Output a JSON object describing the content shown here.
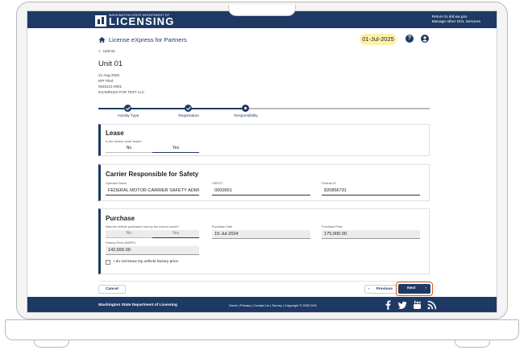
{
  "header": {
    "logo_small": "WASHINGTON STATE DEPARTMENT OF",
    "logo_big": "LICENSING",
    "link_return": "Return to dol.wa.gov",
    "link_manage": "Manage other DOL Services"
  },
  "nav": {
    "app_title": "License eXpress for Partners",
    "date": "01-Jul-2025",
    "help": "?"
  },
  "unit": {
    "back_label": "Unit 01",
    "title": "Unit 01",
    "date": "21-Aug-2026",
    "status": "IRP Filed",
    "account": "0546121-0901",
    "company": "EXAMPLES FOR TEST LLC"
  },
  "stepper": {
    "steps": [
      {
        "label": "Activity Type",
        "state": "complete"
      },
      {
        "label": "Registration",
        "state": "complete"
      },
      {
        "label": "Responsibility",
        "state": "current"
      }
    ]
  },
  "lease": {
    "title": "Lease",
    "question": "Is the vehicle under lease?",
    "options": [
      "No",
      "Yes"
    ],
    "selected": "Yes"
  },
  "carrier": {
    "title": "Carrier Responsible for Safety",
    "operator_label": "Operator Name",
    "operator_value": "FEDERAL MOTOR CARRIER SAFETY ADMINISTRAT",
    "usdot_label": "USDOT",
    "usdot_value": "0000001",
    "federal_label": "Federal ID",
    "federal_value": "820856731"
  },
  "purchase": {
    "title": "Purchase",
    "question": "Was the vehicle purchased new by the current owner?",
    "options": [
      "No",
      "Yes"
    ],
    "selected": "Yes",
    "purchase_date_label": "Purchase Date",
    "purchase_date_value": "15-Jul-2024",
    "purchase_price_label": "Purchase Price",
    "purchase_price_value": "175,000.00",
    "msrp_label": "Factory Price (MSRP)",
    "msrp_value": "142,656.00",
    "checkbox_label": "I do not know my vehicle factory price"
  },
  "actions": {
    "cancel": "Cancel",
    "previous": "Previous",
    "next": "Next"
  },
  "footer": {
    "brand": "Washington State Department of Licensing",
    "links": "Home | Privacy | Contact Us | Survey | Copyright © 2025 DOL"
  },
  "colors": {
    "navy": "#1e3a64",
    "date_pill": "#fbf1a8",
    "highlight": "#e0531f"
  },
  "icons": [
    "home-icon",
    "help-icon",
    "user-icon",
    "chevron-left-icon",
    "check-icon",
    "chevron-right-icon",
    "facebook-icon",
    "twitter-icon",
    "youtube-icon",
    "rss-icon"
  ]
}
